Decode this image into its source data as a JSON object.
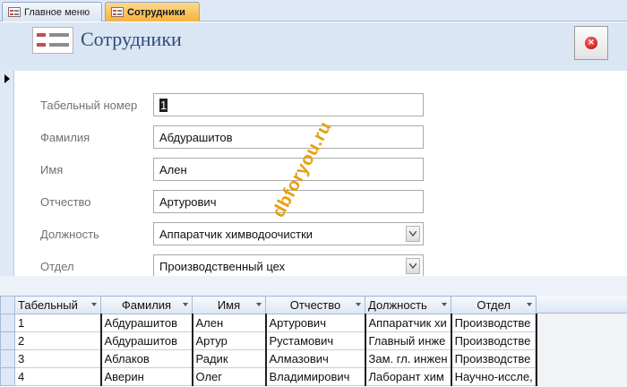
{
  "tabs": [
    {
      "label": "Главное меню",
      "active": false
    },
    {
      "label": "Сотрудники",
      "active": true
    }
  ],
  "header": {
    "title": "Сотрудники"
  },
  "fields": {
    "tab_number": {
      "label": "Табельный номер",
      "value": "1"
    },
    "last_name": {
      "label": "Фамилия",
      "value": "Абдурашитов"
    },
    "first_name": {
      "label": "Имя",
      "value": "Ален"
    },
    "patronymic": {
      "label": "Отчество",
      "value": "Артурович"
    },
    "position": {
      "label": "Должность",
      "value": "Аппаратчик химводоочистки"
    },
    "department": {
      "label": "Отдел",
      "value": "Производственный цех"
    }
  },
  "watermark": "dbforyou.ru",
  "datasheet": {
    "columns": [
      "Табельный",
      "Фамилия",
      "Имя",
      "Отчество",
      "Должность",
      "Отдел"
    ],
    "rows": [
      [
        "1",
        "Абдурашитов",
        "Ален",
        "Артурович",
        "Аппаратчик хи",
        "Производстве"
      ],
      [
        "2",
        "Абдурашитов",
        "Артур",
        "Рустамович",
        "Главный инже",
        "Производстве"
      ],
      [
        "3",
        "Аблаков",
        "Радик",
        "Алмазович",
        "Зам. гл. инжен",
        "Производстве"
      ],
      [
        "4",
        "Аверин",
        "Олег",
        "Владимирович",
        "Лаборант хим",
        "Научно-иссле,"
      ]
    ]
  },
  "colors": {
    "active_tab": "#f6b23c",
    "title": "#2f4c78",
    "header_band": "#dbe6f4",
    "watermark": "#e6a010"
  }
}
